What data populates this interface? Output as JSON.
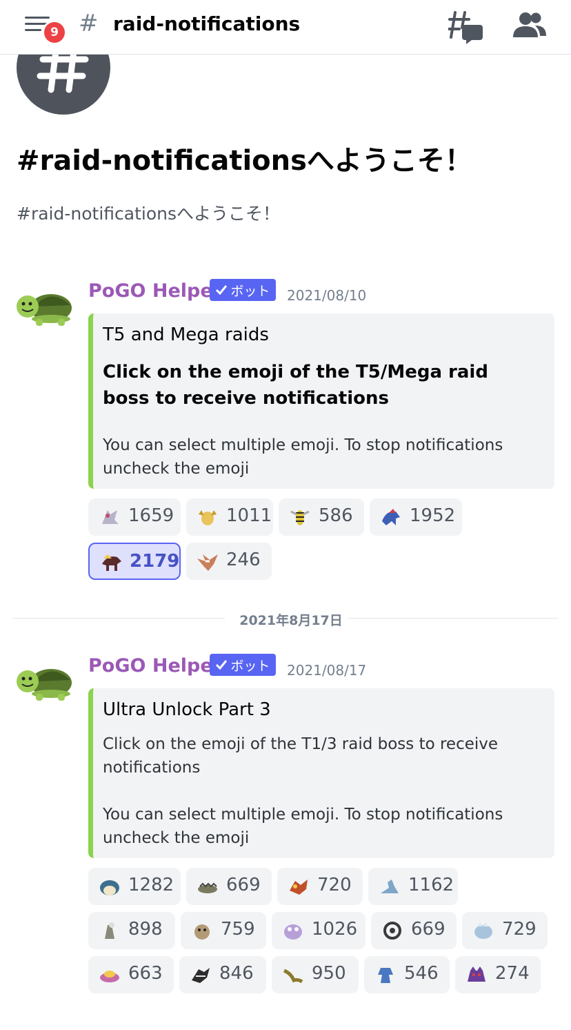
{
  "header": {
    "notification_count": "9",
    "hash": "#",
    "channel_name": "raid-notifications"
  },
  "welcome": {
    "hash": "#",
    "heading": "#raid-notificationsへようこそ！",
    "subtext": "#raid-notificationsへようこそ！"
  },
  "messages": [
    {
      "author": "PoGO Helper",
      "bot_label": "ボット",
      "timestamp": "2021/08/10",
      "embed": {
        "title": "T5 and Mega raids",
        "bold": "Click on the emoji of the T5/Mega raid boss to receive notifications",
        "lines": [
          "You can select multiple emoji. To stop notifications uncheck the emoji"
        ]
      },
      "reactions": [
        {
          "count": "1659",
          "selected": false,
          "color": "#b8b3c9",
          "icon": "pokemon-emoji"
        },
        {
          "count": "1011",
          "selected": false,
          "color": "#e9c45a",
          "icon": "pokemon-emoji"
        },
        {
          "count": "586",
          "selected": false,
          "color": "#e0c43a",
          "icon": "pokemon-emoji"
        },
        {
          "count": "1952",
          "selected": false,
          "color": "#3d5fb8",
          "icon": "pokemon-emoji"
        },
        {
          "count": "2179",
          "selected": true,
          "color": "#5a2a2a",
          "icon": "pokemon-emoji"
        },
        {
          "count": "246",
          "selected": false,
          "color": "#c97f5a",
          "icon": "pokemon-emoji"
        }
      ]
    },
    {
      "author": "PoGO Helper",
      "bot_label": "ボット",
      "timestamp": "2021/08/17",
      "embed": {
        "title": "Ultra Unlock Part 3",
        "lines": [
          "Click on the emoji of the T1/3 raid boss to receive notifications",
          "You can select multiple emoji. To stop notifications uncheck the emoji"
        ]
      },
      "reactions": [
        {
          "count": "1282",
          "selected": false,
          "color": "#3f6f8f",
          "icon": "pokemon-emoji"
        },
        {
          "count": "669",
          "selected": false,
          "color": "#7a7a60",
          "icon": "pokemon-emoji"
        },
        {
          "count": "720",
          "selected": false,
          "color": "#c0502a",
          "icon": "pokemon-emoji"
        },
        {
          "count": "1162",
          "selected": false,
          "color": "#7fa6c8",
          "icon": "pokemon-emoji"
        },
        {
          "count": "898",
          "selected": false,
          "color": "#8a8a7a",
          "icon": "pokemon-emoji"
        },
        {
          "count": "759",
          "selected": false,
          "color": "#b39a76",
          "icon": "pokemon-emoji"
        },
        {
          "count": "1026",
          "selected": false,
          "color": "#b7a0d8",
          "icon": "pokemon-emoji"
        },
        {
          "count": "669",
          "selected": false,
          "color": "#3a3a3a",
          "icon": "pokemon-emoji"
        },
        {
          "count": "729",
          "selected": false,
          "color": "#a8c4dc",
          "icon": "pokemon-emoji"
        },
        {
          "count": "663",
          "selected": false,
          "color": "#c76aa8",
          "icon": "pokemon-emoji"
        },
        {
          "count": "846",
          "selected": false,
          "color": "#2c2c2c",
          "icon": "pokemon-emoji"
        },
        {
          "count": "950",
          "selected": false,
          "color": "#8c7a2c",
          "icon": "pokemon-emoji"
        },
        {
          "count": "546",
          "selected": false,
          "color": "#4a78c0",
          "icon": "pokemon-emoji"
        },
        {
          "count": "274",
          "selected": false,
          "color": "#6a3d9a",
          "icon": "pokemon-emoji"
        }
      ]
    }
  ],
  "date_divider": "2021年8月17日",
  "colors": {
    "blurple": "#5865f2",
    "embed_accent": "#8bd34f",
    "author": "#9b59b6",
    "badge": "#ed4245"
  }
}
